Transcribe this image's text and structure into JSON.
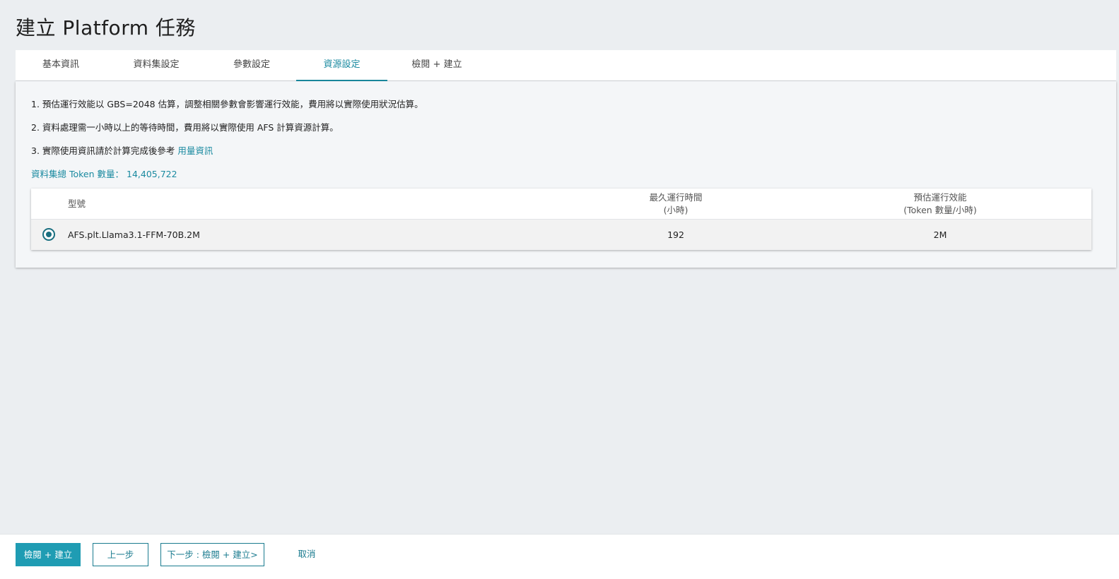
{
  "page": {
    "title": "建立 Platform 任務"
  },
  "tabs": [
    {
      "label": "基本資訊"
    },
    {
      "label": "資料集設定"
    },
    {
      "label": "參數設定"
    },
    {
      "label": "資源設定"
    },
    {
      "label": "檢閱 + 建立"
    }
  ],
  "active_tab": "資源設定",
  "notes": {
    "n1": "1. 預估運行效能以 GBS=2048 估算，調整相關參數會影響運行效能，費用將以實際使用狀況估算。",
    "n2": "2. 資料處理需一小時以上的等待時間，費用將以實際使用 AFS 計算資源計算。",
    "n3_prefix": "3. 實際使用資訊請於計算完成後參考 ",
    "n3_link": "用量資訊"
  },
  "token": {
    "label": "資料集總 Token 數量：",
    "value": "14,405,722"
  },
  "table": {
    "headers": {
      "model": "型號",
      "max_runtime_l1": "最久運行時間",
      "max_runtime_l2": "(小時)",
      "perf_l1": "預估運行效能",
      "perf_l2": "(Token 數量/小時)"
    },
    "rows": [
      {
        "model": "AFS.plt.Llama3.1-FFM-70B.2M",
        "max_runtime": "192",
        "perf": "2M",
        "selected": true
      }
    ]
  },
  "footer": {
    "primary": "檢閱 + 建立",
    "prev": "上一步",
    "next": "下一步 : 檢閱 + 建立>",
    "cancel": "取消"
  },
  "colors": {
    "accent": "#1a8aa0",
    "primary_button": "#1f9cb3",
    "background": "#ebeef1"
  }
}
